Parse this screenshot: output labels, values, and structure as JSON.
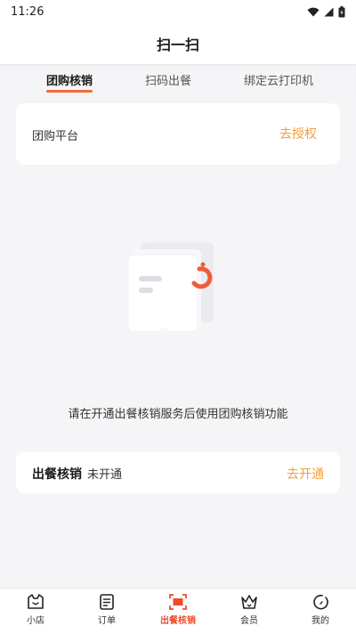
{
  "status_bar": {
    "time": "11:26",
    "icons": [
      "wifi-icon",
      "signal-icon",
      "battery-icon"
    ]
  },
  "header": {
    "title": "扫一扫"
  },
  "tabs": [
    {
      "label": "团购核销",
      "active": true
    },
    {
      "label": "扫码出餐",
      "active": false
    },
    {
      "label": "绑定云打印机",
      "active": false
    }
  ],
  "platform_card": {
    "label": "团购平台",
    "action": "去授权"
  },
  "empty_state": {
    "illustration": "document-loading-illustration",
    "hint": "请在开通出餐核销服务后使用团购核销功能"
  },
  "service_card": {
    "label": "出餐核销",
    "status": "未开通",
    "action": "去开通"
  },
  "bottom_nav": [
    {
      "label": "小店",
      "icon": "cat-icon",
      "active": false
    },
    {
      "label": "订单",
      "icon": "order-list-icon",
      "active": false
    },
    {
      "label": "出餐核销",
      "icon": "scan-icon",
      "active": true
    },
    {
      "label": "会员",
      "icon": "crown-icon",
      "active": false
    },
    {
      "label": "我的",
      "icon": "profile-circle-icon",
      "active": false
    }
  ],
  "colors": {
    "accent": "#f26b3a",
    "link": "#f0a040",
    "active_nav": "#f04a2a"
  }
}
